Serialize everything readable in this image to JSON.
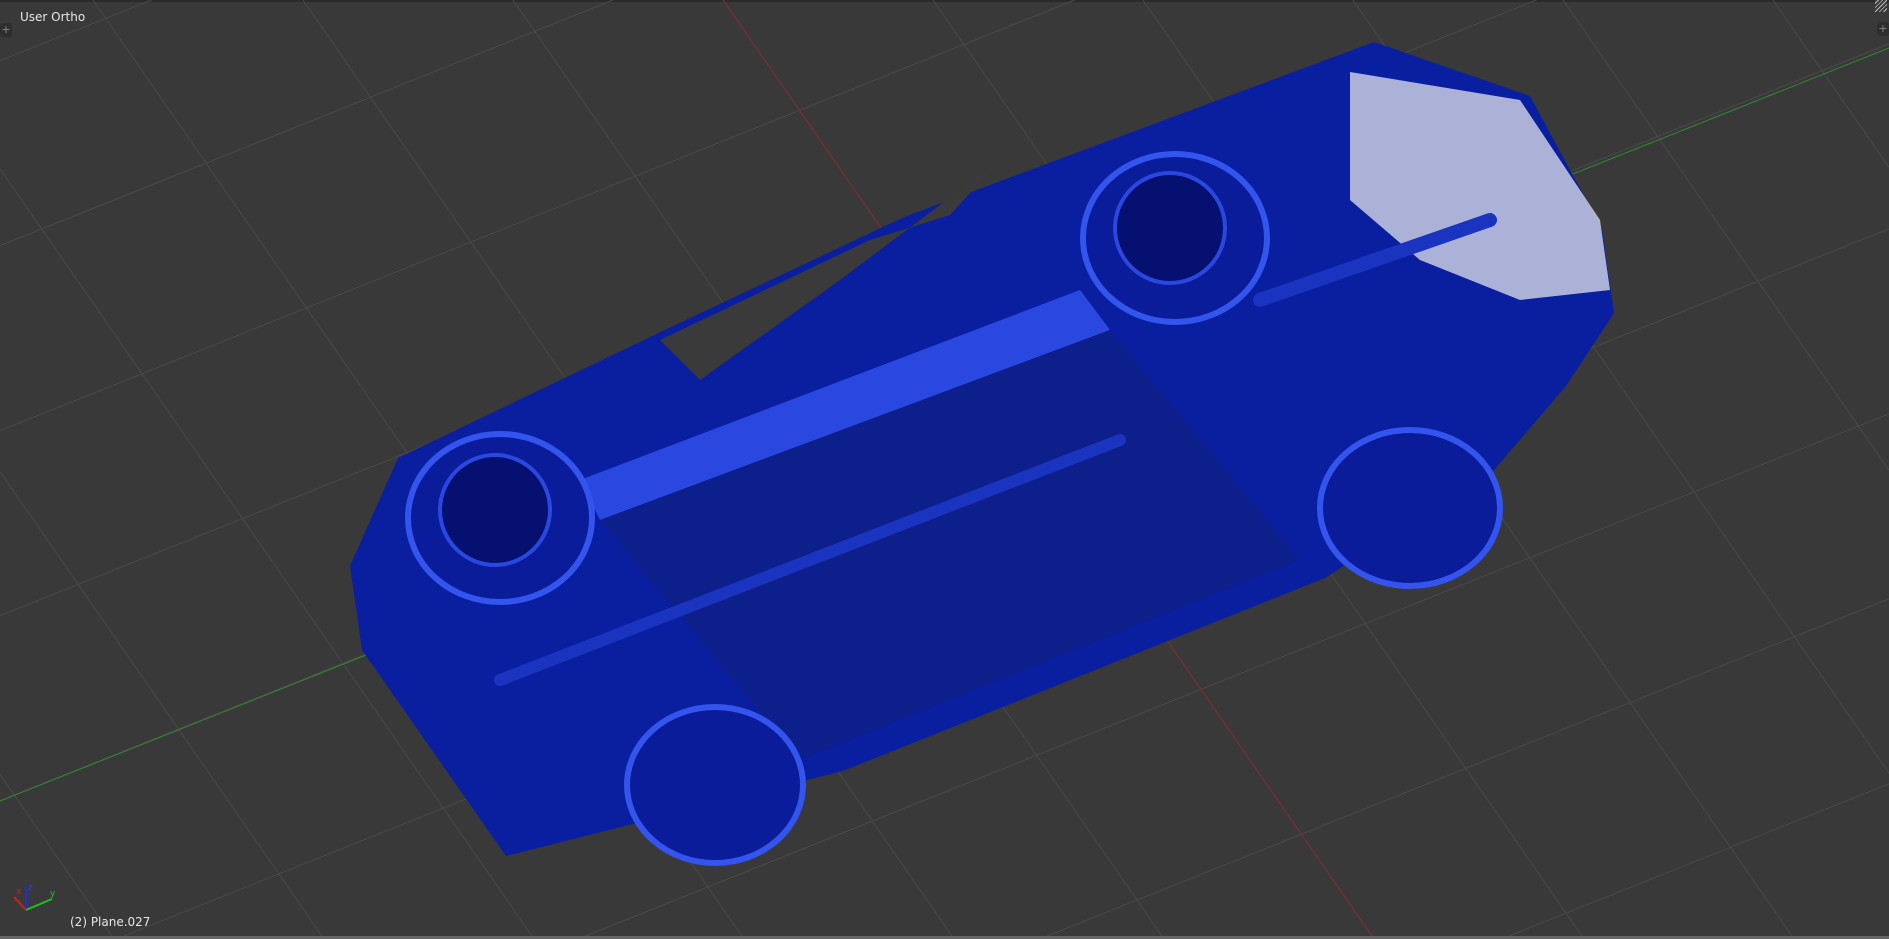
{
  "viewport": {
    "view_name": "User Ortho",
    "active_object": "(2) Plane.027",
    "gizmo": {
      "x": "x",
      "y": "y",
      "z": "z"
    },
    "icons": {
      "toolbar_toggle": "plus-icon",
      "properties_toggle": "plus-icon",
      "split_corner": "corner-hatch-icon"
    }
  },
  "colors": {
    "background": "#393939",
    "grid": "#4a4a4a",
    "x_axis": "#8a2a2a",
    "y_axis": "#2f8a2f",
    "car_body": "#0a1fa0",
    "car_highlight": "#2a48e0",
    "car_interior": "#c9cde0"
  }
}
